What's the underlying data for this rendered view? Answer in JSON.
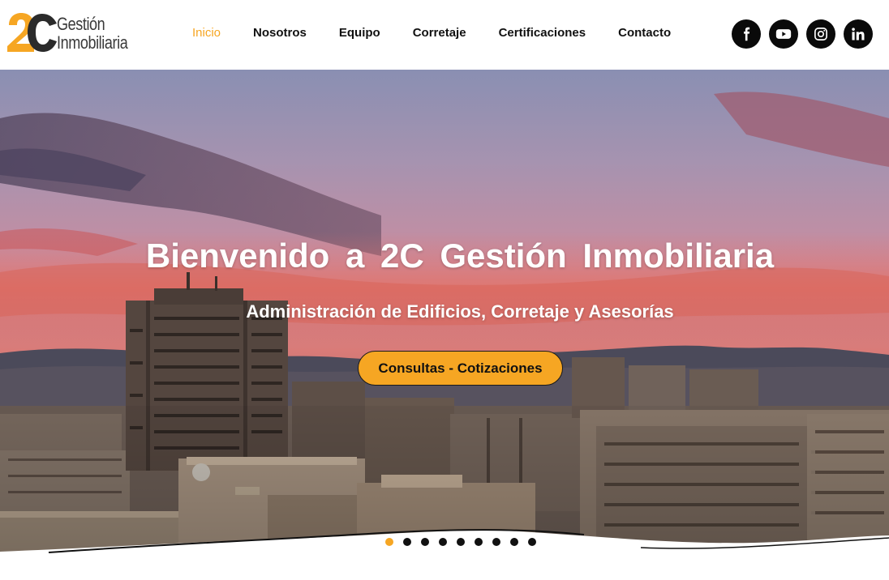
{
  "logo": {
    "mark": "2C",
    "line1": "Gestión",
    "line2": "Inmobiliaria",
    "colors": {
      "orange": "#f6a623",
      "dark": "#3a3a3a"
    }
  },
  "nav": {
    "items": [
      {
        "label": "Inicio",
        "active": true
      },
      {
        "label": "Nosotros",
        "active": false
      },
      {
        "label": "Equipo",
        "active": false
      },
      {
        "label": "Corretaje",
        "active": false
      },
      {
        "label": "Certificaciones",
        "active": false
      },
      {
        "label": "Contacto",
        "active": false
      }
    ],
    "active_color": "#f6a623"
  },
  "socials": [
    {
      "icon": "facebook-icon"
    },
    {
      "icon": "youtube-icon"
    },
    {
      "icon": "instagram-icon"
    },
    {
      "icon": "linkedin-icon"
    }
  ],
  "hero": {
    "title": "Bienvenido a 2C Gestión Inmobiliaria",
    "subtitle": "Administración de Edificios, Corretaje y Asesorías",
    "button_label": "Consultas - Cotizaciones",
    "button_color": "#f6a623",
    "slides": {
      "count": 9,
      "active_index": 0
    }
  }
}
